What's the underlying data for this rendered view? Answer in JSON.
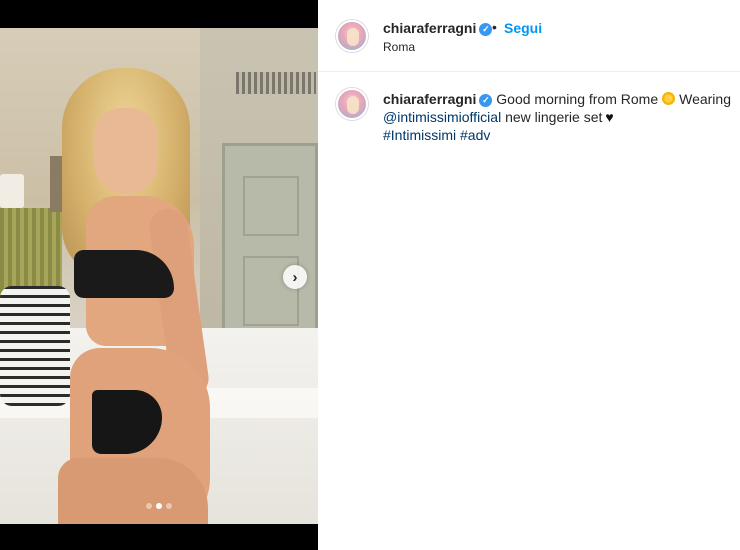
{
  "post": {
    "author": "chiaraferragni",
    "follow_label": "Segui",
    "separator": "•",
    "location": "Roma",
    "verified_icon": "verified-badge-icon",
    "verified_glyph": "✓",
    "caption": {
      "text_1": "Good morning from Rome",
      "emoji_sun": "sun-emoji-icon",
      "text_2": "Wearing",
      "mention": "@intimissimiofficial",
      "text_3": "new lingerie set",
      "heart": "♥",
      "hashtag_1": "#Intimissimi",
      "hashtag_2": "#adv"
    },
    "carousel": {
      "next_glyph": "›",
      "current_index": 2,
      "total": 3
    }
  },
  "colors": {
    "follow_blue": "#0095f6",
    "link_navy": "#00376b",
    "verified_blue": "#3897f0"
  }
}
